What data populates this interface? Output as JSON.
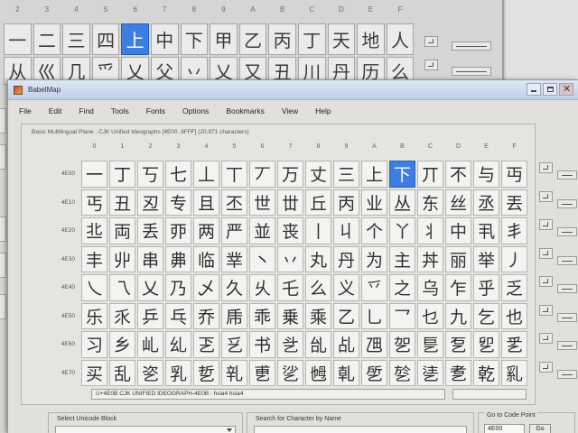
{
  "background_window": {
    "column_headers": [
      "2",
      "3",
      "4",
      "5",
      "6",
      "7",
      "8",
      "9",
      "A",
      "B",
      "C",
      "D",
      "E",
      "F"
    ],
    "rows": [
      [
        "一",
        "二",
        "三",
        "四",
        "上",
        "中",
        "下",
        "甲",
        "乙",
        "丙",
        "丁",
        "天",
        "地",
        "人"
      ],
      [
        "从",
        "巛",
        "几",
        "爫",
        "乂",
        "父",
        "丷",
        "乂",
        "又",
        "丑",
        "川",
        "丹",
        "历",
        "么"
      ]
    ],
    "selected": {
      "row": 0,
      "col": 4
    }
  },
  "window": {
    "title": "BabelMap",
    "menu": [
      "File",
      "Edit",
      "Find",
      "Tools",
      "Fonts",
      "Options",
      "Bookmarks",
      "View",
      "Help"
    ],
    "plane_label": "Basic Multilingual Plane : CJK Unified Ideographs [4E00..9FFF] (20,971 characters)",
    "column_headers": [
      "0",
      "1",
      "2",
      "3",
      "4",
      "5",
      "6",
      "7",
      "8",
      "9",
      "A",
      "B",
      "C",
      "D",
      "E",
      "F"
    ],
    "rows": [
      {
        "label": "4E00",
        "chars": [
          "一",
          "丁",
          "丂",
          "七",
          "丄",
          "丅",
          "丆",
          "万",
          "丈",
          "三",
          "上",
          "下",
          "丌",
          "不",
          "与",
          "丏"
        ]
      },
      {
        "label": "4E10",
        "chars": [
          "丐",
          "丑",
          "丒",
          "专",
          "且",
          "丕",
          "世",
          "丗",
          "丘",
          "丙",
          "业",
          "丛",
          "东",
          "丝",
          "丞",
          "丟"
        ]
      },
      {
        "label": "4E20",
        "chars": [
          "丠",
          "両",
          "丢",
          "丣",
          "两",
          "严",
          "並",
          "丧",
          "丨",
          "丩",
          "个",
          "丫",
          "丬",
          "中",
          "丮",
          "丯"
        ]
      },
      {
        "label": "4E30",
        "chars": [
          "丰",
          "丱",
          "串",
          "丳",
          "临",
          "丵",
          "丶",
          "丷",
          "丸",
          "丹",
          "为",
          "主",
          "丼",
          "丽",
          "举",
          "丿"
        ]
      },
      {
        "label": "4E40",
        "chars": [
          "乀",
          "乁",
          "乂",
          "乃",
          "乄",
          "久",
          "乆",
          "乇",
          "么",
          "义",
          "乊",
          "之",
          "乌",
          "乍",
          "乎",
          "乏"
        ]
      },
      {
        "label": "4E50",
        "chars": [
          "乐",
          "乑",
          "乒",
          "乓",
          "乔",
          "乕",
          "乖",
          "乗",
          "乘",
          "乙",
          "乚",
          "乛",
          "乜",
          "九",
          "乞",
          "也"
        ]
      },
      {
        "label": "4E60",
        "chars": [
          "习",
          "乡",
          "乢",
          "乣",
          "乤",
          "乥",
          "书",
          "乧",
          "乨",
          "乩",
          "乪",
          "乫",
          "乬",
          "乭",
          "乮",
          "乯"
        ]
      },
      {
        "label": "4E70",
        "chars": [
          "买",
          "乱",
          "乲",
          "乳",
          "乴",
          "乵",
          "乶",
          "乷",
          "乸",
          "乹",
          "乺",
          "乻",
          "乼",
          "乽",
          "乾",
          "乿"
        ]
      }
    ],
    "selected_code_point": "4E0B",
    "status": "U+4E0B CJK UNIFIED IDEOGRAPH-4E0B : hsia4 hsia4",
    "select_block_label": "Select Unicode Block",
    "search_label": "Search for Character by Name",
    "goto_label": "Go to Code Point",
    "goto_value": "4E00",
    "goto_button": "Go"
  },
  "colors": {
    "selection": "#3d7fe0"
  }
}
